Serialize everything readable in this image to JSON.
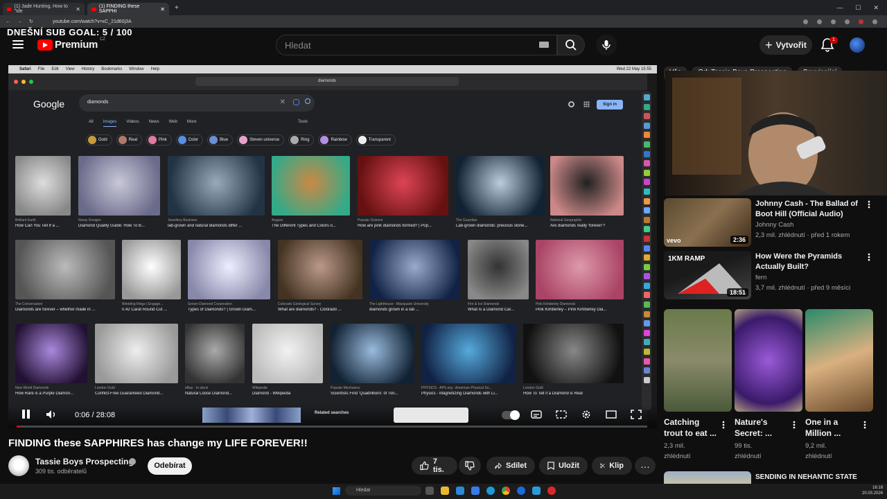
{
  "browser": {
    "tabs": [
      {
        "title": "(1) Jade Hunting, How to \"Ide"
      },
      {
        "title": "(1) FINDING these SAPPHI"
      }
    ],
    "url": "youtube.com/watch?v=xC_21d60j3A"
  },
  "overlay": {
    "sub_goal": "DNEŠNÍ SUB GOAL: 5 / 100"
  },
  "header": {
    "logo": "Premium",
    "logo_region": "CZ",
    "search_placeholder": "Hledat",
    "create_label": "Vytvořit",
    "notification_count": "1"
  },
  "screen": {
    "mac_menu": [
      "Safari",
      "File",
      "Edit",
      "View",
      "History",
      "Bookmarks",
      "Window",
      "Help"
    ],
    "mac_clock": "Wed 22 May 15:55",
    "safari_address": "diamonds",
    "google": {
      "logo": "Google",
      "query": "diamonds",
      "signin": "Sign in",
      "tabs": [
        "All",
        "Images",
        "Videos",
        "News",
        "Web",
        "More"
      ],
      "active_tab": "Images",
      "tools": "Tools",
      "chips": [
        {
          "label": "Gold",
          "color": "#c79a3a"
        },
        {
          "label": "Real",
          "color": "#b0796c"
        },
        {
          "label": "Pink",
          "color": "#e07aa0"
        },
        {
          "label": "Color",
          "color": "#5b8de0"
        },
        {
          "label": "Blue",
          "color": "#6d8fd1"
        },
        {
          "label": "Steven universe",
          "color": "#e6a3c8"
        },
        {
          "label": "Ring",
          "color": "#aaaaaa"
        },
        {
          "label": "Rainbow",
          "color": "#b48ee0"
        },
        {
          "label": "Transparent",
          "color": "#eeeeee"
        }
      ],
      "results": [
        {
          "source": "Brilliant Earth",
          "title": "How Can You Tell If a ..."
        },
        {
          "source": "Noray Designs",
          "title": "Diamond Quality Guide: How To B..."
        },
        {
          "source": "Jewellery Business",
          "title": "lab-grown and natural diamonds differ ..."
        },
        {
          "source": "Angara",
          "title": "The Different Types and Colors o..."
        },
        {
          "source": "Popular Science",
          "title": "How are pink diamonds formed? | Pop..."
        },
        {
          "source": "The Guardian",
          "title": "Lab-grown diamonds: precious stone..."
        },
        {
          "source": "National Geographic",
          "title": "Are diamonds really 'forever'?"
        },
        {
          "source": "The Conversation",
          "title": "Diamonds are forever – whether made in ..."
        },
        {
          "source": "Wedding Rings | Engage...",
          "title": "0.42 Carat Round Cut ..."
        },
        {
          "source": "Grown Diamond Corporation",
          "title": "Types of Diamonds? | Grown Diam..."
        },
        {
          "source": "Colorado Geological Survey",
          "title": "What are diamonds? - Colorado ..."
        },
        {
          "source": "The Lighthouse - Macquarie University",
          "title": "diamonds grown in a lab ..."
        },
        {
          "source": "Fire & Ice Diamonds",
          "title": "What Is a Diamond Car..."
        },
        {
          "source": "Pink Kimberley Diamonds",
          "title": "Pink Kimberley – Pink Kimberley Dia..."
        },
        {
          "source": "New World Diamonds",
          "title": "How Rare is a Purple Diamon..."
        },
        {
          "source": "London Gold",
          "title": "Conflict-Free Guaranteed Diamond..."
        },
        {
          "source": "eBay · In stock",
          "title": "Natural Loose Diamond..."
        },
        {
          "source": "Wikipedia",
          "title": "Diamond - Wikipedia"
        },
        {
          "source": "Popular Mechanics",
          "title": "Scientists Find 'Quadrillions' of Ton..."
        },
        {
          "source": "PHYSICS - APS.org - American Physical So...",
          "title": "Physics - Magnetizing Diamonds with Li..."
        },
        {
          "source": "London Gold",
          "title": "How To Tell if a Diamond is Real"
        }
      ],
      "related_label": "Related searches"
    },
    "player": {
      "time": "0:06 / 28:08",
      "progress": 0.004
    }
  },
  "video": {
    "title": "FINDING these SAPPHIRES has change my LIFE FOREVER!!",
    "channel": "Tassie Boys Prospecting",
    "subscribers": "309 tis. odběratelů",
    "subscribe_label": "Odebírat",
    "likes": "7 tis.",
    "share_label": "Sdílet",
    "save_label": "Uložit",
    "clip_label": "Klip"
  },
  "sidebar": {
    "chips": [
      "Vše",
      "Od: Tassie Boys Prospecting",
      "Související"
    ],
    "recommendations": [
      {
        "title_line1": "Johnny Cash - The Ballad of",
        "title_line2": "Boot Hill (Official Audio)",
        "channel": "Johnny Cash",
        "meta": "2,3 mil. zhlédnutí · před 1 rokem",
        "duration": "2:36",
        "thumb_label": "vevo"
      },
      {
        "title_line1": "How Were the Pyramids",
        "title_line2": "Actually Built?",
        "channel": "fern",
        "meta": "3,7 mil. zhlédnutí · před 9 měsíci",
        "duration": "18:51",
        "thumb_label": "1KM RAMP"
      }
    ],
    "shorts": [
      {
        "title_line1": "Catching",
        "title_line2": "trout to eat ...",
        "views_line1": "2,3 mil.",
        "views_line2": "zhlédnutí"
      },
      {
        "title_line1": "Nature's",
        "title_line2": "Secret: ...",
        "views_line1": "99 tis.",
        "views_line2": "zhlédnutí"
      },
      {
        "title_line1": "One in a",
        "title_line2": "Million ...",
        "views_line1": "9,2 mil.",
        "views_line2": "zhlédnutí"
      }
    ],
    "next_title": "SENDING IN NEHANTIC STATE"
  },
  "taskbar": {
    "search_placeholder": "Hledat",
    "time": "16:18",
    "date": "20.03.2026"
  }
}
